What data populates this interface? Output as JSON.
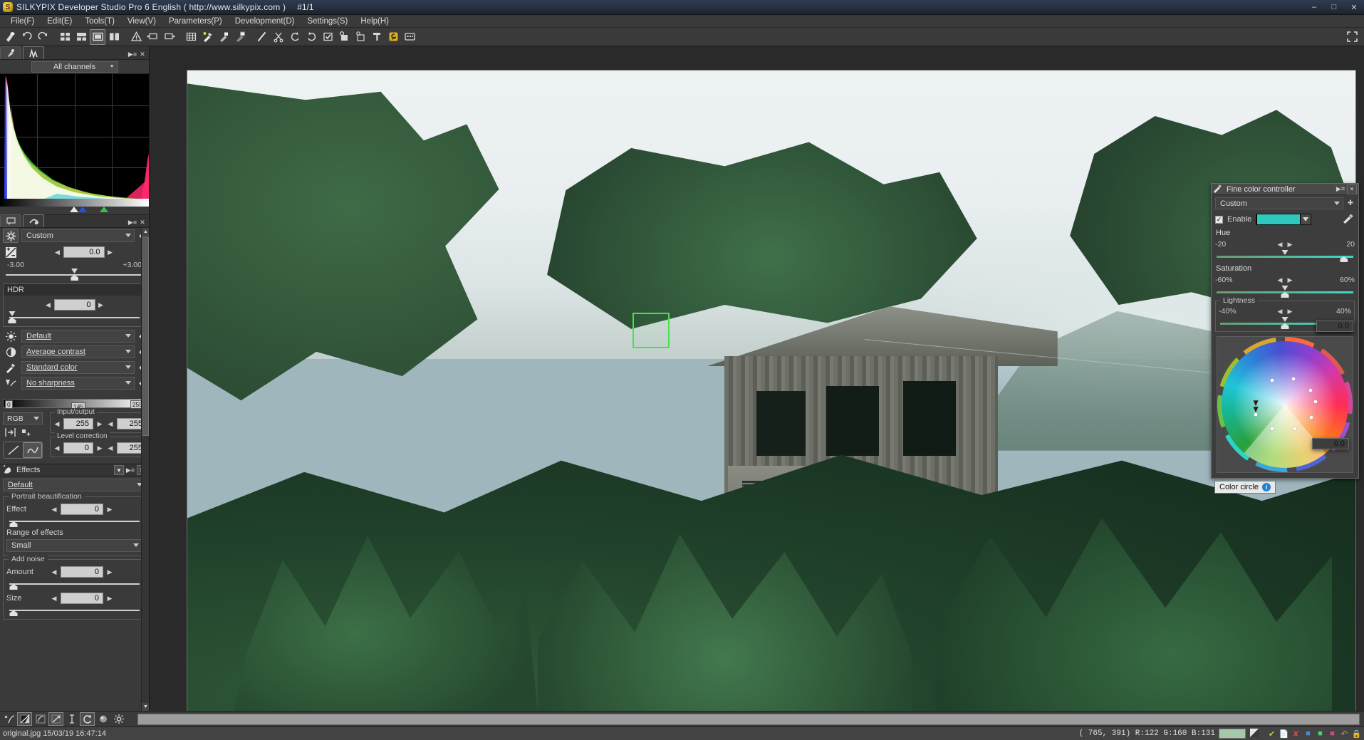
{
  "window": {
    "title": "SILKYPIX Developer Studio Pro 6 English ( http://www.silkypix.com )",
    "image_index": "#1/1",
    "icon": "silkypix-logo-icon",
    "minimize": "–",
    "maximize": "□",
    "close": "✕"
  },
  "menubar": {
    "items": [
      {
        "label": "File(F)",
        "name": "menu-file"
      },
      {
        "label": "Edit(E)",
        "name": "menu-edit"
      },
      {
        "label": "Tools(T)",
        "name": "menu-tools"
      },
      {
        "label": "View(V)",
        "name": "menu-view"
      },
      {
        "label": "Parameters(P)",
        "name": "menu-parameters"
      },
      {
        "label": "Development(D)",
        "name": "menu-development"
      },
      {
        "label": "Settings(S)",
        "name": "menu-settings"
      },
      {
        "label": "Help(H)",
        "name": "menu-help"
      }
    ]
  },
  "toolbar": {
    "items": [
      "brush-icon",
      "undo-icon",
      "redo-icon",
      "thumbnail-grid-icon",
      "thumbnail-list-icon",
      "single-view-icon",
      "split-view-icon",
      "warning-icon",
      "rotate-left-icon",
      "rotate-right-icon",
      "grid-overlay-icon",
      "whitebalance-picker-icon",
      "gray-picker-icon",
      "black-picker-icon",
      "spot-brush-icon",
      "scissors-icon",
      "rotate-ccw-icon",
      "rotate-cw-icon",
      "checkbox-icon",
      "batch-settings-icon",
      "star-settings-icon",
      "hammer-icon",
      "silkypix-badge-icon",
      "display-icon"
    ],
    "fullscreen": "fullscreen-icon"
  },
  "left_panel": {
    "tabs_top": [
      "pin-icon",
      "histogram-icon"
    ],
    "panel_menu_icon": "panel-menu-icon",
    "panel_close_icon": "close-icon",
    "histogram": {
      "channel_select": "All channels",
      "markers": [
        "black-point-marker",
        "mid-point-marker",
        "white-point-marker"
      ]
    },
    "tabs_mid": [
      "comment-icon",
      "develop-icon"
    ],
    "exposure": {
      "preset_icon": "gear-icon",
      "preset": "Custom",
      "ev_icon": "exposure-bias-icon",
      "value": "0.0",
      "min": "-3.00",
      "max": "+3.00"
    },
    "hdr": {
      "label": "HDR",
      "value": "0"
    },
    "presets": [
      {
        "icon": "brightness-icon",
        "label": "Default",
        "name": "preset-tone"
      },
      {
        "icon": "contrast-icon",
        "label": "Average contrast",
        "name": "preset-contrast"
      },
      {
        "icon": "color-icon",
        "label": "Standard color",
        "name": "preset-color"
      },
      {
        "icon": "sharpness-icon",
        "label": "No sharpness",
        "name": "preset-sharpness"
      }
    ],
    "levelbar": {
      "left_tag": "0",
      "mid_tag": "145",
      "right_tag": "255"
    },
    "tone": {
      "channel": "RGB",
      "reset_icon": "reset-levels-icon",
      "add_point_icon": "add-point-icon",
      "curve_linear_icon": "linear-curve-icon",
      "curve_spline_icon": "spline-curve-icon",
      "input_output": {
        "label": "Input/output",
        "a": "255",
        "b": "255"
      },
      "level_correction": {
        "label": "Level correction",
        "a": "0",
        "b": "255"
      }
    },
    "effects": {
      "icon": "effects-icon",
      "title": "Effects",
      "preset": "Default",
      "portrait": {
        "label": "Portrait beautification",
        "effect_label": "Effect",
        "effect_value": "0",
        "range_label": "Range of effects",
        "range_value": "Small"
      },
      "noise": {
        "label": "Add noise",
        "amount_label": "Amount",
        "amount_value": "0",
        "size_label": "Size",
        "size_value": "0"
      }
    }
  },
  "fine_color_controller": {
    "title": "Fine color controller",
    "title_icon": "color-dropper-icon",
    "menu_icon": "panel-menu-icon",
    "close_icon": "close-icon",
    "preset": "Custom",
    "add_icon": "add-preset-icon",
    "enable_label": "Enable",
    "enable_checked": "✓",
    "swatch_color": "#2ec8bd",
    "picker_icon": "color-picker-icon",
    "hue": {
      "label": "Hue",
      "min": "-20",
      "value": "19.0",
      "max": "20"
    },
    "saturation": {
      "label": "Saturation",
      "min": "-60%",
      "value": "0.0",
      "max": "60%"
    },
    "lightness": {
      "label": "Lightness",
      "min": "-40%",
      "value": "0.0",
      "max": "40%"
    },
    "color_circle_tooltip": "Color circle",
    "info_icon": "info-icon"
  },
  "bottom_toolbar": {
    "items": [
      "noise-reduction-icon",
      "tone-curve-icon",
      "highlight-icon",
      "sharpen-icon",
      "text-icon",
      "rotate-icon",
      "lens-icon",
      "settings-gear-icon"
    ]
  },
  "statusbar": {
    "file": "original.jpg 15/03/19 16:47:14",
    "coords": "( 765, 391) R:122 G:160 B:131",
    "sample_color": "#a5c8ab",
    "sample_icon": "sample-size-icon",
    "icons": [
      "check-icon",
      "copy-icon",
      "delete-icon",
      "blue-tag-icon",
      "green-tag-icon",
      "red-tag-icon",
      "undo-icon",
      "lock-icon"
    ]
  },
  "colors": {
    "accent_teal": "#2ec8bd",
    "selection_green": "#4ae04a",
    "panel_bg": "#3a3a3a",
    "title_bg": "#26303f"
  }
}
